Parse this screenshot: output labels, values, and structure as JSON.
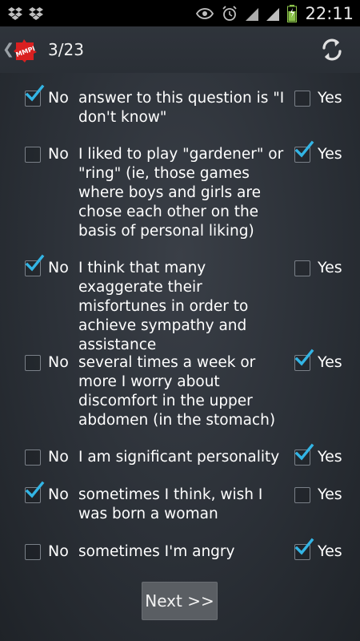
{
  "status_bar": {
    "time": "22:11",
    "icons": [
      "dropbox-icon",
      "dropbox-icon",
      "eye-icon",
      "alarm-icon",
      "wifi-icon",
      "signal-icon",
      "battery-charging-icon"
    ]
  },
  "action_bar": {
    "progress": "3/23",
    "logo_text": "MMPI"
  },
  "labels": {
    "no": "No",
    "yes": "Yes"
  },
  "questions": [
    {
      "text": "answer to this question is \"I don't know\"",
      "answer": "no"
    },
    {
      "text": "I liked to play \"gardener\" or \"ring\" (ie, those games where boys and girls are chose each other on the basis of personal liking)",
      "answer": "yes"
    },
    {
      "text": "I think that many exaggerate their misfortunes in order to achieve sympathy and assistance",
      "answer": "no"
    },
    {
      "text": "several times a week or more I worry about discomfort in the upper abdomen (in the stomach)",
      "answer": "yes"
    },
    {
      "text": "I am significant personality",
      "answer": "yes"
    },
    {
      "text": "sometimes I think, wish I was born a woman",
      "answer": "no"
    },
    {
      "text": "sometimes I'm angry",
      "answer": "yes"
    }
  ],
  "next_button": {
    "label": "Next >>"
  },
  "colors": {
    "check": "#33b5e5",
    "background": "#2b3037",
    "button": "#5a5e63"
  }
}
